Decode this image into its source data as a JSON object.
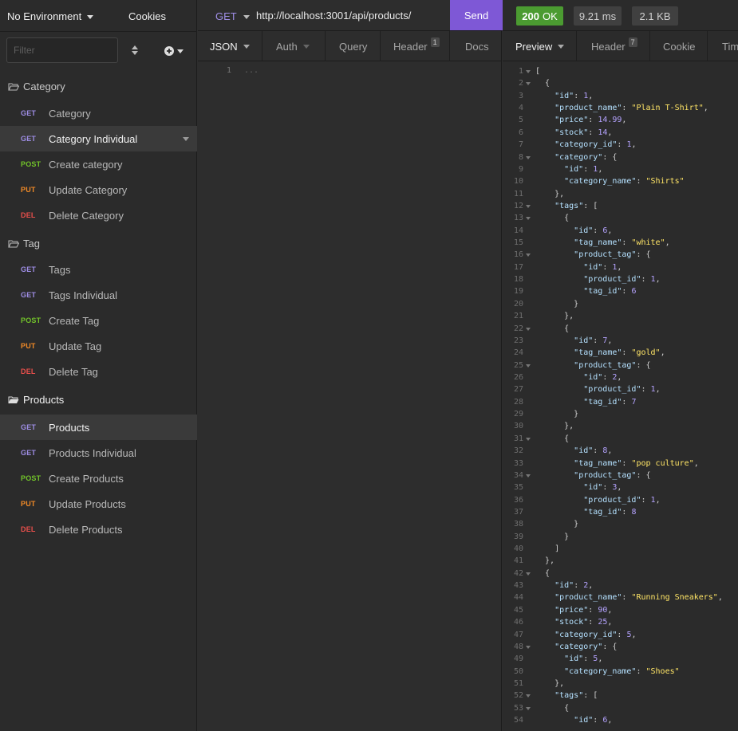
{
  "sidebar": {
    "environment": "No Environment",
    "cookies": "Cookies",
    "filter_placeholder": "Filter",
    "groups": [
      {
        "name": "Category",
        "open": false,
        "items": [
          {
            "method": "GET",
            "label": "Category"
          },
          {
            "method": "GET",
            "label": "Category Individual"
          },
          {
            "method": "POST",
            "label": "Create category"
          },
          {
            "method": "PUT",
            "label": "Update Category"
          },
          {
            "method": "DEL",
            "label": "Delete Category"
          }
        ]
      },
      {
        "name": "Tag",
        "open": false,
        "items": [
          {
            "method": "GET",
            "label": "Tags"
          },
          {
            "method": "GET",
            "label": "Tags Individual"
          },
          {
            "method": "POST",
            "label": "Create Tag"
          },
          {
            "method": "PUT",
            "label": "Update Tag"
          },
          {
            "method": "DEL",
            "label": "Delete Tag"
          }
        ]
      },
      {
        "name": "Products",
        "open": true,
        "items": [
          {
            "method": "GET",
            "label": "Products"
          },
          {
            "method": "GET",
            "label": "Products Individual"
          },
          {
            "method": "POST",
            "label": "Create Products"
          },
          {
            "method": "PUT",
            "label": "Update Products"
          },
          {
            "method": "DEL",
            "label": "Delete Products"
          }
        ]
      }
    ]
  },
  "request": {
    "method": "GET",
    "url": "http://localhost:3001/api/products/",
    "send": "Send",
    "tabs": [
      {
        "label": "JSON"
      },
      {
        "label": "Auth"
      },
      {
        "label": "Query"
      },
      {
        "label": "Header",
        "badge": "1"
      },
      {
        "label": "Docs"
      }
    ],
    "editor_line": "1",
    "editor_text": "..."
  },
  "response": {
    "status_code": "200",
    "status_text": "OK",
    "time": "9.21 ms",
    "size": "2.1 KB",
    "tabs": [
      {
        "label": "Preview"
      },
      {
        "label": "Header",
        "badge": "7"
      },
      {
        "label": "Cookie"
      },
      {
        "label": "Timeline"
      }
    ],
    "code_lines": [
      "[",
      "  {",
      "    \"id\": 1,",
      "    \"product_name\": \"Plain T-Shirt\",",
      "    \"price\": 14.99,",
      "    \"stock\": 14,",
      "    \"category_id\": 1,",
      "    \"category\": {",
      "      \"id\": 1,",
      "      \"category_name\": \"Shirts\"",
      "    },",
      "    \"tags\": [",
      "      {",
      "        \"id\": 6,",
      "        \"tag_name\": \"white\",",
      "        \"product_tag\": {",
      "          \"id\": 1,",
      "          \"product_id\": 1,",
      "          \"tag_id\": 6",
      "        }",
      "      },",
      "      {",
      "        \"id\": 7,",
      "        \"tag_name\": \"gold\",",
      "        \"product_tag\": {",
      "          \"id\": 2,",
      "          \"product_id\": 1,",
      "          \"tag_id\": 7",
      "        }",
      "      },",
      "      {",
      "        \"id\": 8,",
      "        \"tag_name\": \"pop culture\",",
      "        \"product_tag\": {",
      "          \"id\": 3,",
      "          \"product_id\": 1,",
      "          \"tag_id\": 8",
      "        }",
      "      }",
      "    ]",
      "  },",
      "  {",
      "    \"id\": 2,",
      "    \"product_name\": \"Running Sneakers\",",
      "    \"price\": 90,",
      "    \"stock\": 25,",
      "    \"category_id\": 5,",
      "    \"category\": {",
      "      \"id\": 5,",
      "      \"category_name\": \"Shoes\"",
      "    },",
      "    \"tags\": [",
      "      {",
      "        \"id\": 6,"
    ],
    "fold_lines": [
      1,
      2,
      8,
      12,
      13,
      16,
      22,
      25,
      31,
      34,
      42,
      48,
      52,
      53
    ]
  },
  "colors": {
    "accent": "#7e58d6",
    "status_ok": "#4b9b31",
    "get": "#9f8ee6",
    "post": "#72c32a",
    "put": "#f18a27",
    "delete": "#e94f4b"
  }
}
